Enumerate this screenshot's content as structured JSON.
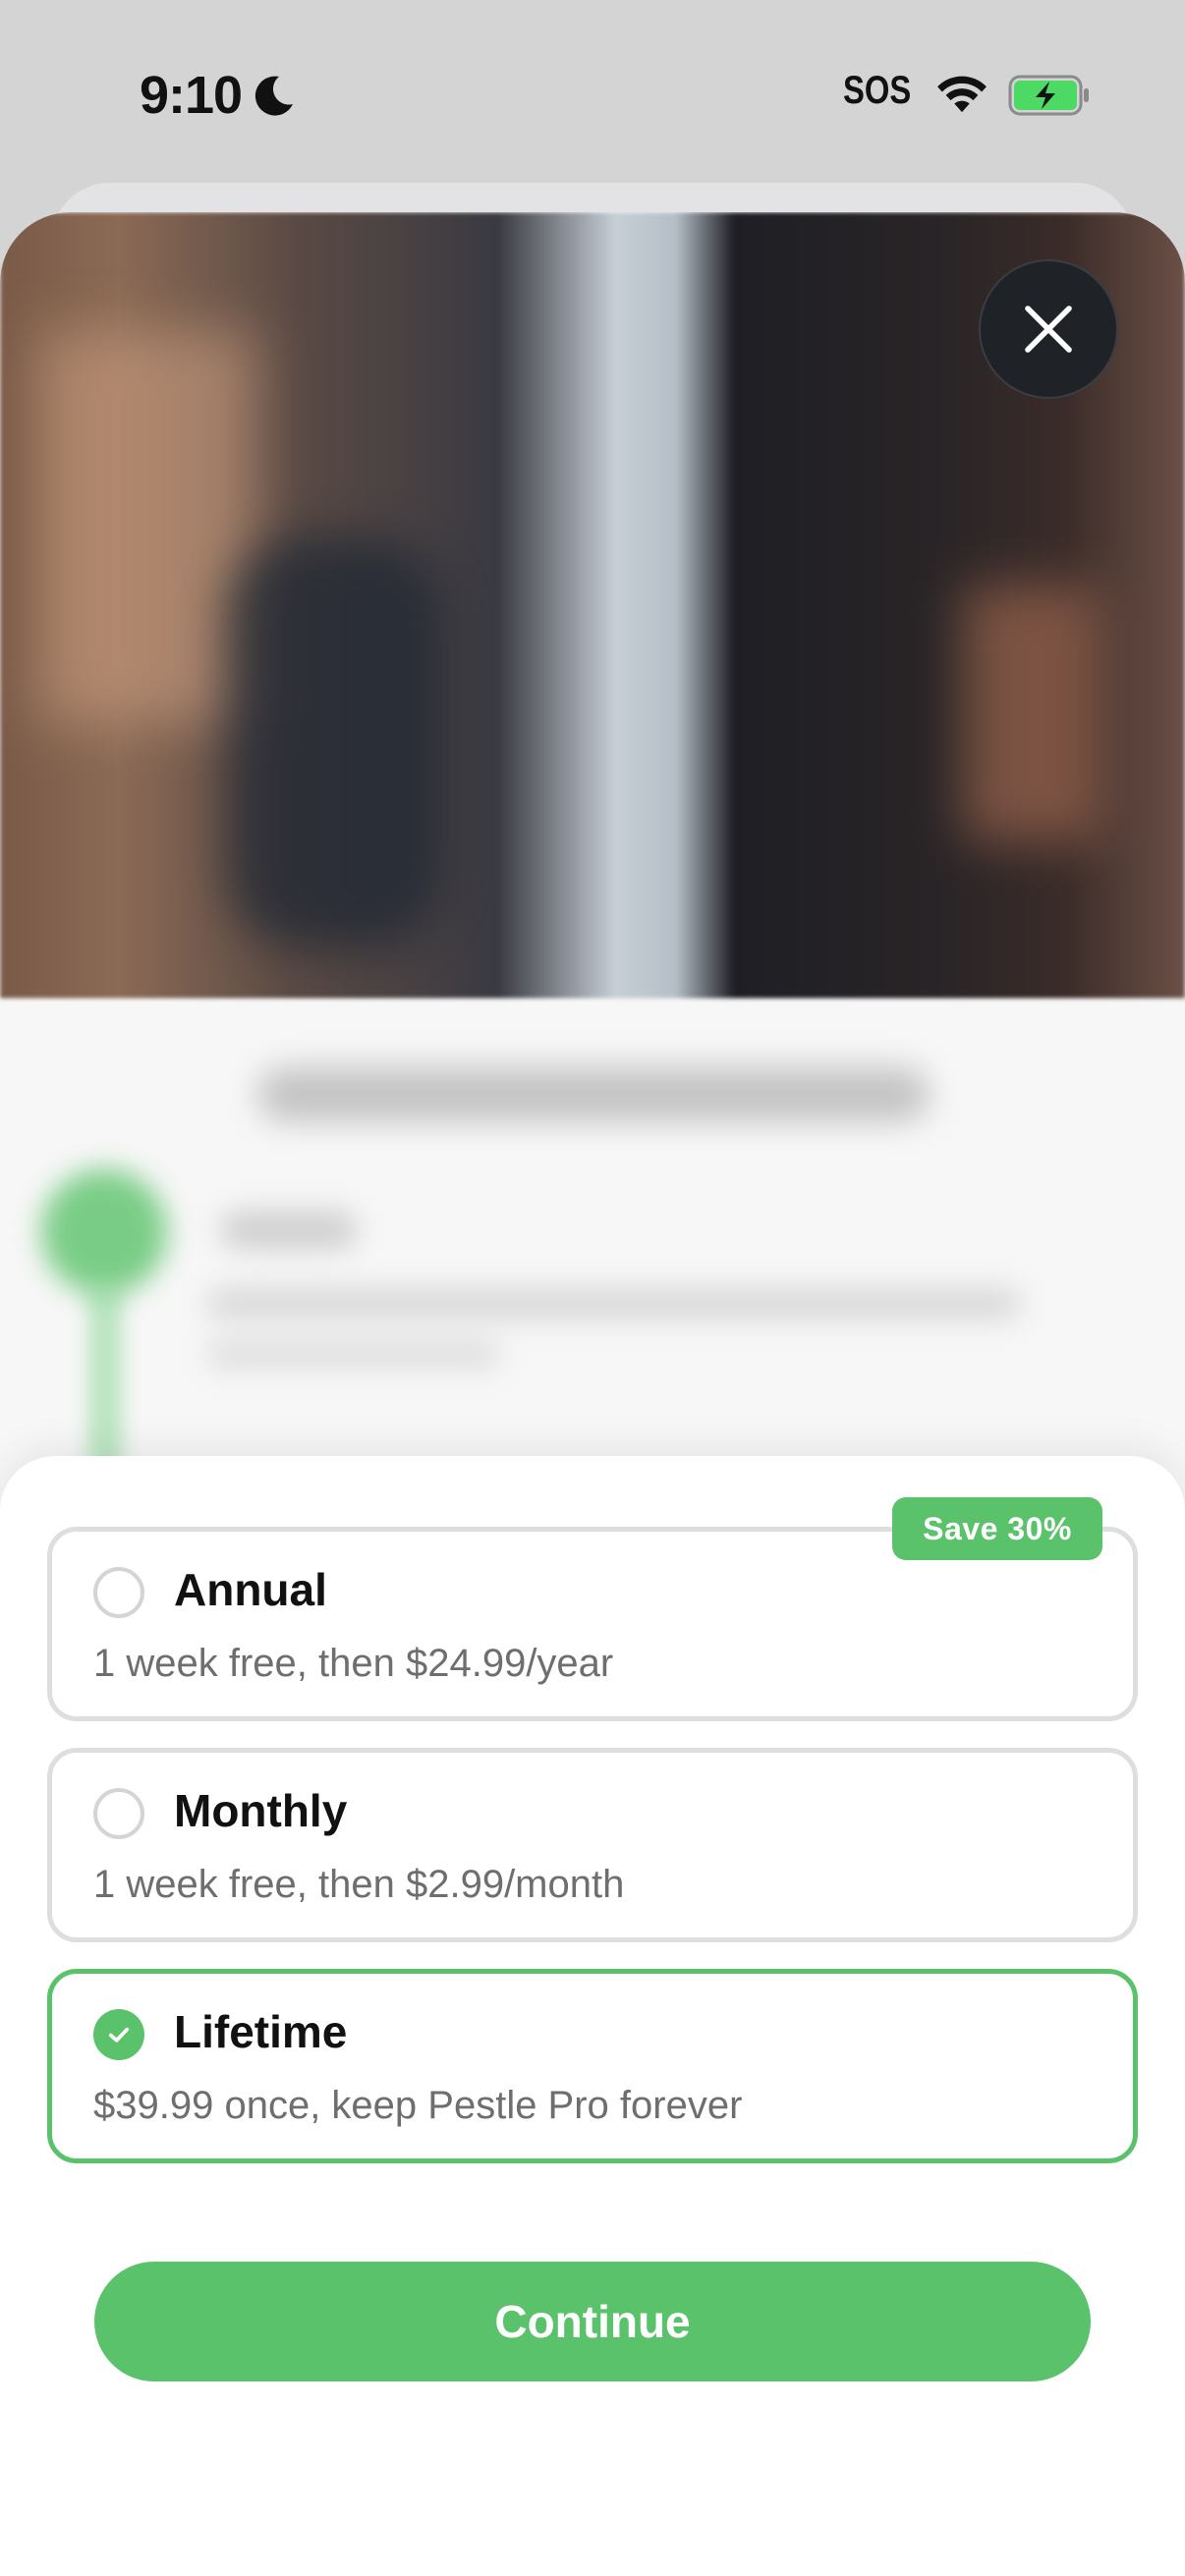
{
  "status_bar": {
    "time": "9:10",
    "sos": "SOS",
    "icons": [
      "moon-icon",
      "wifi-icon",
      "battery-charging-icon"
    ]
  },
  "close_icon": "close-icon",
  "badge": {
    "label": "Save 30%"
  },
  "plans": [
    {
      "name": "Annual",
      "description": "1 week free, then $24.99/year",
      "selected": false
    },
    {
      "name": "Monthly",
      "description": "1 week free, then $2.99/month",
      "selected": false
    },
    {
      "name": "Lifetime",
      "description": "$39.99 once, keep Pestle Pro forever",
      "selected": true
    }
  ],
  "cta": {
    "label": "Continue"
  },
  "colors": {
    "accent": "#5ac26a",
    "battery": "#4cd964"
  }
}
